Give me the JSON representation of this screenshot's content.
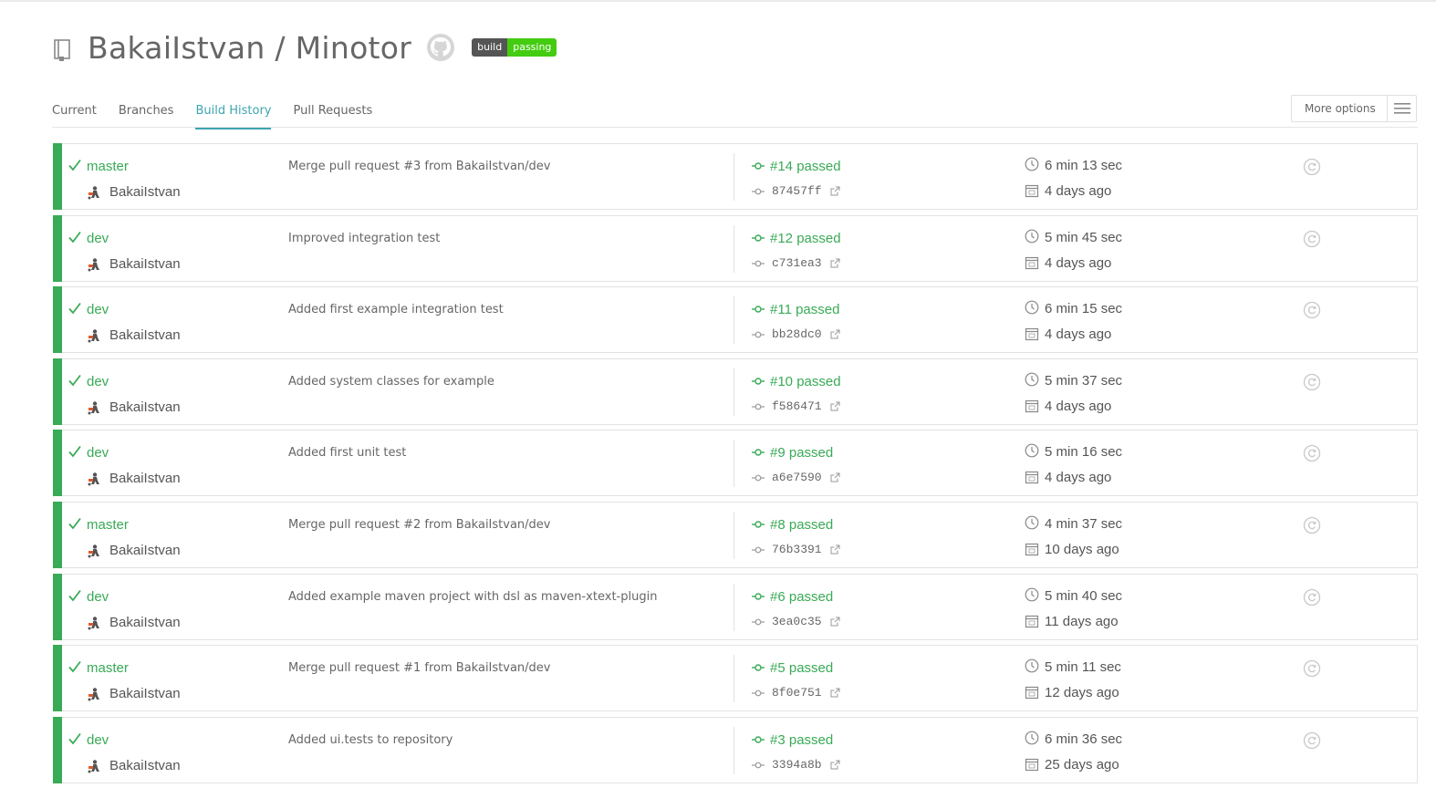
{
  "repo": {
    "title": "BakaiIstvan / Minotor",
    "icons": [
      "repo-icon",
      "github-icon"
    ],
    "badge": {
      "left": "build",
      "right": "passing",
      "left_color": "#555555",
      "right_color": "#44cc11"
    }
  },
  "tabs": [
    {
      "label": "Current",
      "active": false
    },
    {
      "label": "Branches",
      "active": false
    },
    {
      "label": "Build History",
      "active": true
    },
    {
      "label": "Pull Requests",
      "active": false
    }
  ],
  "more_options": {
    "label": "More options",
    "icon": "hamburger-menu-icon"
  },
  "colors": {
    "passed": "#39aa56",
    "active_tab": "#3ea5b0",
    "text": "#555555"
  },
  "builds": [
    {
      "branch": "master",
      "author": "BakaiIstvan",
      "message": "Merge pull request #3 from BakaiIstvan/dev",
      "build": "#14 passed",
      "sha": "87457ff",
      "duration": "6 min 13 sec",
      "finished": "4 days ago"
    },
    {
      "branch": "dev",
      "author": "BakaiIstvan",
      "message": "Improved integration test",
      "build": "#12 passed",
      "sha": "c731ea3",
      "duration": "5 min 45 sec",
      "finished": "4 days ago"
    },
    {
      "branch": "dev",
      "author": "BakaiIstvan",
      "message": "Added first example integration test",
      "build": "#11 passed",
      "sha": "bb28dc0",
      "duration": "6 min 15 sec",
      "finished": "4 days ago"
    },
    {
      "branch": "dev",
      "author": "BakaiIstvan",
      "message": "Added system classes for example",
      "build": "#10 passed",
      "sha": "f586471",
      "duration": "5 min 37 sec",
      "finished": "4 days ago"
    },
    {
      "branch": "dev",
      "author": "BakaiIstvan",
      "message": "Added first unit test",
      "build": "#9 passed",
      "sha": "a6e7590",
      "duration": "5 min 16 sec",
      "finished": "4 days ago"
    },
    {
      "branch": "master",
      "author": "BakaiIstvan",
      "message": "Merge pull request #2 from BakaiIstvan/dev",
      "build": "#8 passed",
      "sha": "76b3391",
      "duration": "4 min 37 sec",
      "finished": "10 days ago"
    },
    {
      "branch": "dev",
      "author": "BakaiIstvan",
      "message": "Added example maven project with dsl as maven-xtext-plugin",
      "build": "#6 passed",
      "sha": "3ea0c35",
      "duration": "5 min 40 sec",
      "finished": "11 days ago"
    },
    {
      "branch": "master",
      "author": "BakaiIstvan",
      "message": "Merge pull request #1 from BakaiIstvan/dev",
      "build": "#5 passed",
      "sha": "8f0e751",
      "duration": "5 min 11 sec",
      "finished": "12 days ago"
    },
    {
      "branch": "dev",
      "author": "BakaiIstvan",
      "message": "Added ui.tests to repository",
      "build": "#3 passed",
      "sha": "3394a8b",
      "duration": "6 min 36 sec",
      "finished": "25 days ago"
    }
  ]
}
